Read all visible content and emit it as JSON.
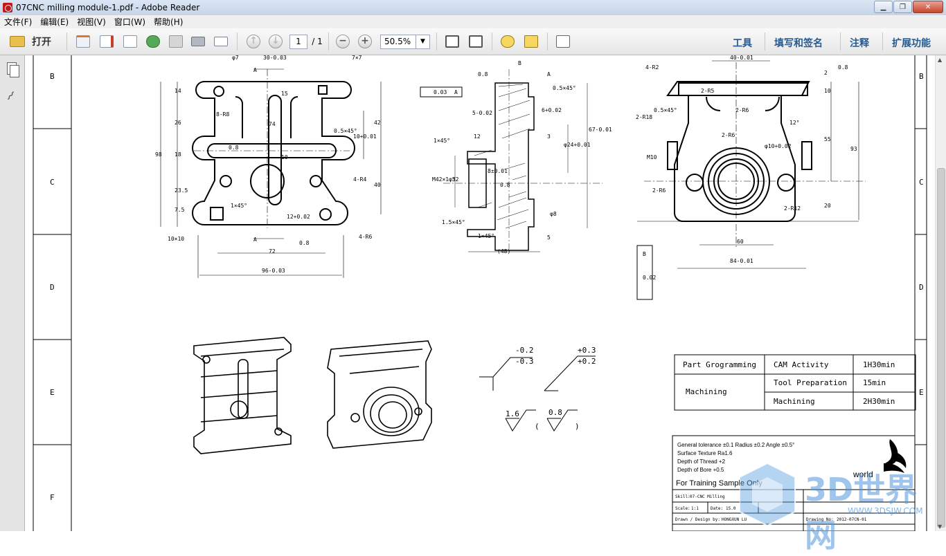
{
  "window": {
    "title": "07CNC milling module-1.pdf - Adobe Reader"
  },
  "menu": {
    "items": [
      "文件(F)",
      "编辑(E)",
      "视图(V)",
      "窗口(W)",
      "帮助(H)"
    ]
  },
  "toolbar": {
    "open_label": "打开",
    "page_current": "1",
    "page_total": "/ 1",
    "zoom": "50.5%",
    "tools_label": "工具",
    "fill_sign_label": "填写和签名",
    "comment_label": "注释",
    "extend_label": "扩展功能"
  },
  "drawing": {
    "row_letters": [
      "B",
      "C",
      "D",
      "E",
      "F"
    ],
    "front_dims": [
      "φ7",
      "30-0.03",
      "7×7",
      "14",
      "15",
      "26",
      "74",
      "0.5×45°",
      "10+0.01",
      "42",
      "98",
      "8-R8",
      "0.8",
      "18",
      "23.5",
      "10",
      "4-R4",
      "40",
      "1×45°",
      "7.5",
      "12+0.02",
      "4-R6",
      "10×10",
      "72",
      "96-0.03",
      "A",
      "A",
      "0.8"
    ],
    "section_dims": [
      "B",
      "A",
      "0.8",
      "0.5×45°",
      "0.03",
      "A",
      "5-0.02",
      "6+0.02",
      "1×45°",
      "12",
      "3",
      "8±0.01",
      "φ24+0.01",
      "67-0.01",
      "M42×1.5",
      "φ32",
      "0.8",
      "1.5×45°",
      "φ8",
      "1×45°",
      "5",
      "(48)"
    ],
    "side_dims": [
      "4-R2",
      "40-0.01",
      "0.8",
      "2",
      "10",
      "2-R5",
      "0.5×45°",
      "2-R6",
      "2-R18",
      "12°",
      "2-R6",
      "φ10+0.02",
      "55",
      "93",
      "M10",
      "2-R6",
      "2-R12",
      "20",
      "60",
      "84-0.01",
      "0.02",
      "B"
    ],
    "tolerance_labels": [
      "-0.2",
      "-0.3",
      "+0.3",
      "+0.2",
      "1.6",
      "0.8",
      "(",
      ")"
    ],
    "time_table": {
      "rows": [
        [
          "Part Grogramming",
          "CAM Activity",
          "1H30min"
        ],
        [
          "Machining",
          "Tool Preparation",
          "15min"
        ],
        [
          "",
          "Machining",
          "2H30min"
        ]
      ]
    },
    "notes": [
      "General tolerance ±0.1  Radius ±0.2  Angle ±0.5°",
      "Surface Texture Ra1.6",
      "Depth of Thread +2",
      "Depth of Bore +0.5"
    ],
    "training": "For Training Sample Only",
    "title_block": {
      "skill_label": "Skill:",
      "skill_value": "07-CNC Milling",
      "scale_label": "Scale:",
      "scale_value": "1:1",
      "date_label": "Date:",
      "date_value": "15.0",
      "drawn_label": "Drawn / Design by:",
      "drawn_value": "HONGXUN LU",
      "drawing_no_label": "Drawing No:",
      "drawing_no_value": "2012-07CN-01",
      "brand": "world"
    },
    "watermark": {
      "main": "3D世界网",
      "sub": "WWW.3DSJW.COM"
    }
  }
}
